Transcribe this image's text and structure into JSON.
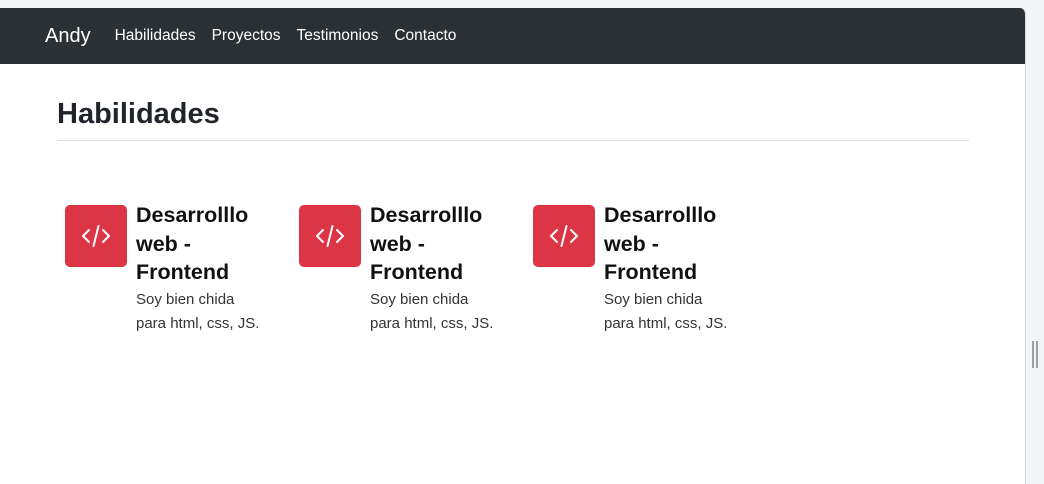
{
  "navbar": {
    "brand": "Andy",
    "links": [
      "Habilidades",
      "Proyectos",
      "Testimonios",
      "Contacto"
    ]
  },
  "section": {
    "title": "Habilidades"
  },
  "skills": [
    {
      "icon": "code-icon",
      "title": "Desarrolllo web - Frontend",
      "text": "Soy bien chida para html, css, JS."
    },
    {
      "icon": "code-icon",
      "title": "Desarrolllo web - Frontend",
      "text": "Soy bien chida para html, css, JS."
    },
    {
      "icon": "code-icon",
      "title": "Desarrolllo web - Frontend",
      "text": "Soy bien chida para html, css, JS."
    }
  ],
  "colors": {
    "navbar_bg": "#2b3035",
    "accent": "#dc3545"
  }
}
